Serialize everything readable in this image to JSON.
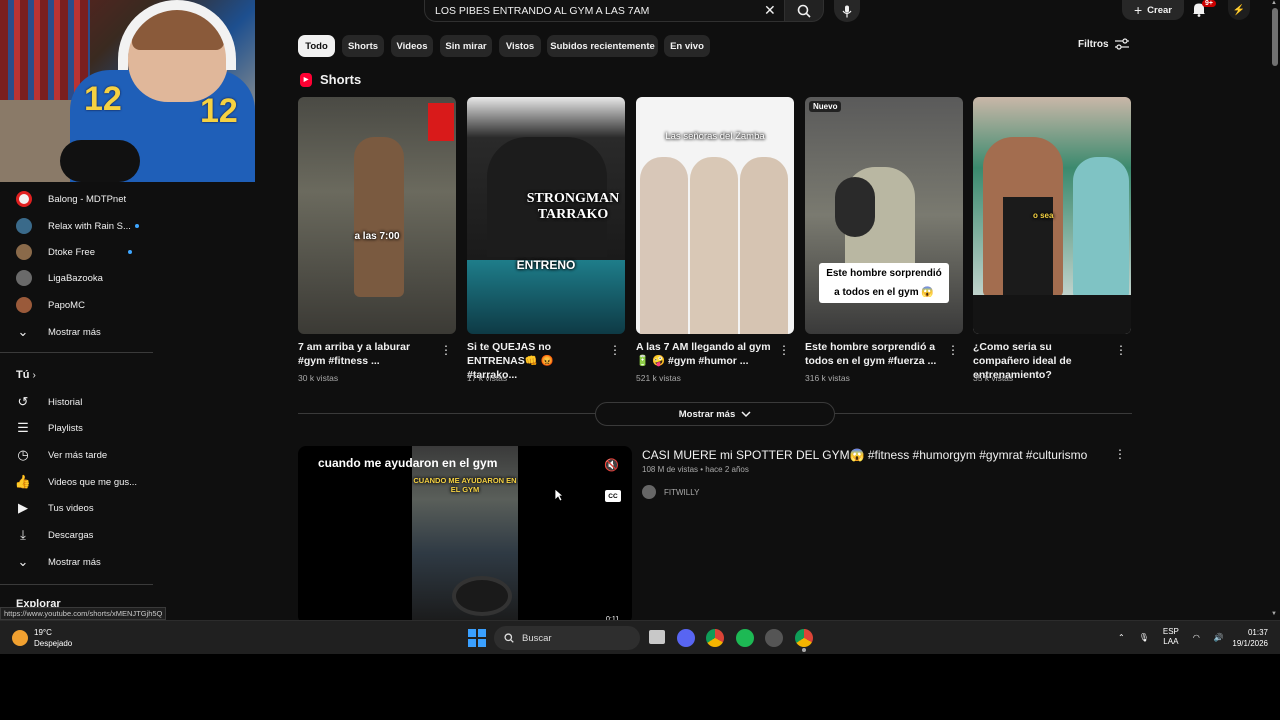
{
  "search": {
    "query": "LOS PIBES ENTRANDO AL GYM A LAS 7AM"
  },
  "topbar": {
    "create_label": "Crear",
    "notif_badge": "9+"
  },
  "webcam": {
    "jersey_number": "12"
  },
  "subscriptions": [
    {
      "name": "Balong - MDTPnet",
      "avatar_color": "#e02020"
    },
    {
      "name": "Relax with Rain S...",
      "avatar_color": "#3a6a8a",
      "new": true
    },
    {
      "name": "Dtoke Free",
      "avatar_color": "#8a6a4a",
      "new": true
    },
    {
      "name": "LigaBazooka",
      "avatar_color": "#6a6a6a"
    },
    {
      "name": "PapoMC",
      "avatar_color": "#9a5a3a"
    }
  ],
  "subs_more": "Mostrar más",
  "you": {
    "heading": "Tú",
    "items": [
      {
        "label": "Historial",
        "icon": "history-icon"
      },
      {
        "label": "Playlists",
        "icon": "playlist-icon"
      },
      {
        "label": "Ver más tarde",
        "icon": "clock-icon"
      },
      {
        "label": "Videos que me gus...",
        "icon": "thumbs-up-icon"
      },
      {
        "label": "Tus videos",
        "icon": "video-icon"
      },
      {
        "label": "Descargas",
        "icon": "download-icon"
      },
      {
        "label": "Mostrar más",
        "icon": "chevron-down-icon"
      }
    ]
  },
  "explore": "Explorar",
  "chips": [
    "Todo",
    "Shorts",
    "Videos",
    "Sin mirar",
    "Vistos",
    "Subidos recientemente",
    "En vivo"
  ],
  "filters_label": "Filtros",
  "shorts": {
    "heading": "Shorts",
    "items": [
      {
        "title": "7 am arriba y a laburar #gym #fitness ...",
        "views": "30 k vistas",
        "overlay": "a las 7:00"
      },
      {
        "title": "Si te QUEJAS no ENTRENAS👊 😡 #tarrako...",
        "views": "17 k vistas",
        "overlay": "ENTRENO",
        "overlay2": "STRONGMAN TARRAKO"
      },
      {
        "title": "A las 7 AM llegando al gym 🔋 🤪 #gym #humor ...",
        "views": "521 k vistas",
        "overlay": "Las señoras del Zamba"
      },
      {
        "title": "Este hombre sorprendió a todos en el gym #fuerza ...",
        "views": "316 k vistas",
        "overlay": "Este hombre sorprendió a todos en el gym 😱",
        "badge": "Nuevo"
      },
      {
        "title": "¿Como seria su compañero ideal de entrenamiento?",
        "views": "35 k vistas",
        "overlay": "o sea"
      }
    ],
    "more_label": "Mostrar más"
  },
  "video": {
    "title": "CASI MUERE mi SPOTTER DEL GYM😱 #fitness #humorgym #gymrat #culturismo",
    "meta": "108 M de vistas • hace 2 años",
    "channel": "FITWILLY",
    "caption": "cuando me ayudaron en el gym",
    "inner_caption": "CUANDO ME AYUDARON EN EL GYM",
    "duration": "0:11"
  },
  "status_url": "https://www.youtube.com/shorts/xMENJTGjh5Q",
  "taskbar": {
    "temp": "19°C",
    "weather": "Despejado",
    "search": "Buscar",
    "lang1": "ESP",
    "lang2": "LAA",
    "time": "01:37",
    "date": "19/1/2026"
  }
}
